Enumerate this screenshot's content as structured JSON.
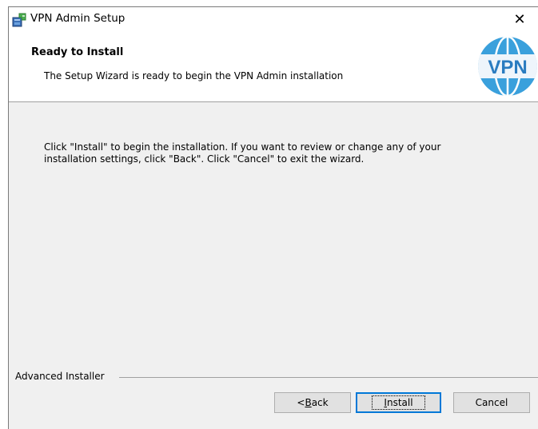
{
  "window": {
    "title": "VPN Admin Setup",
    "close_glyph": "✕"
  },
  "banner": {
    "title": "Ready to Install",
    "subtitle": "The Setup Wizard is ready to begin the VPN Admin installation",
    "logo_text": "VPN"
  },
  "body": {
    "line1": "Click \"Install\" to begin the installation.  If you want to review or change any of your",
    "line2": "installation settings, click \"Back\".  Click \"Cancel\" to exit the wizard."
  },
  "footer": {
    "brand_label": "Advanced Installer"
  },
  "buttons": {
    "back_prefix": "< ",
    "back_accel": "B",
    "back_rest": "ack",
    "install_accel": "I",
    "install_rest": "nstall",
    "cancel": "Cancel"
  },
  "colors": {
    "logo_blue": "#3aa0dc",
    "logo_text": "#2a7cc0",
    "default_button_border": "#0078d7"
  },
  "icons": {
    "app": "installer-package-icon",
    "close": "close-icon",
    "logo": "vpn-globe-logo"
  }
}
